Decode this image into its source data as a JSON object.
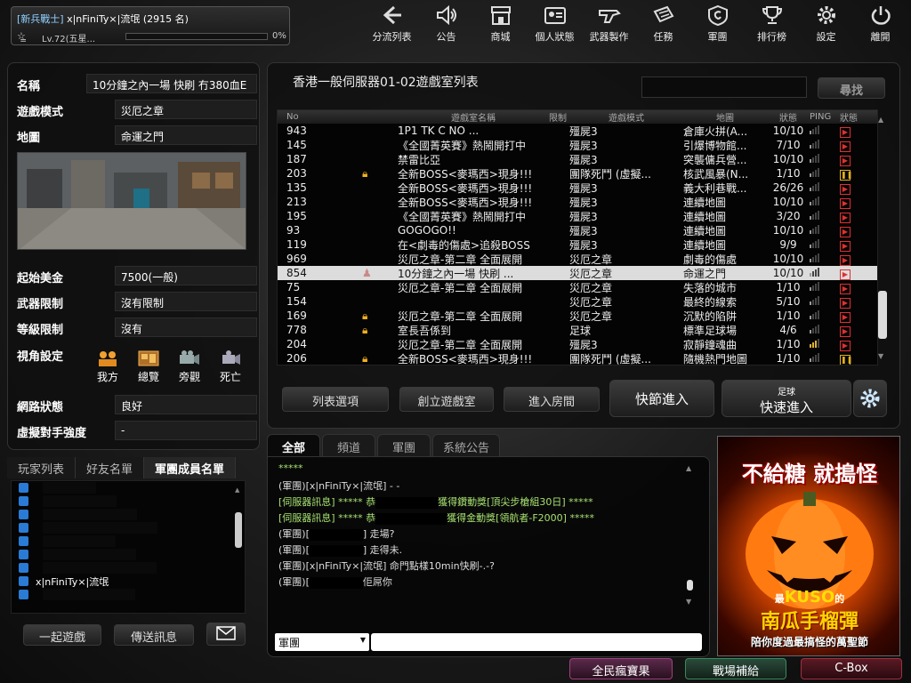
{
  "player": {
    "clan_tag": "[新兵戰士]",
    "name": "x|nFiniTy×|流氓",
    "score": "(2915 名)",
    "level": "Lv.72(五星...",
    "exp_pct": "0%",
    "exp_fill": 0.0
  },
  "nav": [
    {
      "id": "nav-channel",
      "label": "分流列表",
      "icon": "back-arrow-icon"
    },
    {
      "id": "nav-news",
      "label": "公告",
      "icon": "speaker-icon"
    },
    {
      "id": "nav-shop",
      "label": "商城",
      "icon": "shop-icon"
    },
    {
      "id": "nav-profile",
      "label": "個人狀態",
      "icon": "id-card-icon"
    },
    {
      "id": "nav-craft",
      "label": "武器製作",
      "icon": "gun-icon"
    },
    {
      "id": "nav-mission",
      "label": "任務",
      "icon": "mission-icon"
    },
    {
      "id": "nav-clan",
      "label": "軍團",
      "icon": "clan-icon"
    },
    {
      "id": "nav-rank",
      "label": "排行榜",
      "icon": "trophy-icon"
    },
    {
      "id": "nav-settings",
      "label": "設定",
      "icon": "gear-icon"
    },
    {
      "id": "nav-exit",
      "label": "離開",
      "icon": "power-icon"
    }
  ],
  "room_info": {
    "name_label": "名稱",
    "name_value": "10分鐘之內一場 快刷 冇380血E",
    "mode_label": "遊戲模式",
    "mode_value": "災厄之章",
    "map_label": "地圖",
    "map_value": "命運之門",
    "money_label": "起始美金",
    "money_value": "7500(一般)",
    "weapon_label": "武器限制",
    "weapon_value": "沒有限制",
    "level_label": "等級限制",
    "level_value": "沒有",
    "view_label": "視角設定",
    "views": [
      "我方",
      "總覽",
      "旁觀",
      "死亡"
    ],
    "net_label": "網路狀態",
    "net_value": "良好",
    "ai_label": "虛擬對手強度",
    "ai_value": "-"
  },
  "player_tabs": [
    "玩家列表",
    "好友名單",
    "軍團成員名單"
  ],
  "player_list": [
    "",
    "",
    "",
    "",
    "",
    "",
    "",
    "x|nFiniTy×|流氓",
    ""
  ],
  "player_buttons": {
    "play_together": "一起遊戲",
    "send_message": "傳送訊息"
  },
  "room_list": {
    "title": "香港一般伺服器01-02遊戲室列表",
    "search_btn": "尋找",
    "search_value": "",
    "headers": {
      "no": "No",
      "name": "遊戲室名稱",
      "limit": "限制",
      "mode": "遊戲模式",
      "map": "地圖",
      "status": "狀態",
      "ping": "PING",
      "state": "狀態"
    },
    "rows": [
      {
        "no": "943",
        "lock": false,
        "name": "1P1  TK  C NO  ...",
        "mode": "殭屍3",
        "map": "倉庫火拼(A...",
        "status": "10/10",
        "ping": 1,
        "act": "play"
      },
      {
        "no": "145",
        "lock": false,
        "name": "《全國菁英賽》熱鬧開打中",
        "mode": "殭屍3",
        "map": "引爆博物館...",
        "status": "7/10",
        "ping": 1,
        "act": "play"
      },
      {
        "no": "187",
        "lock": false,
        "name": "禁雷比亞",
        "mode": "殭屍3",
        "map": "突襲傭兵營...",
        "status": "10/10",
        "ping": 1,
        "act": "play"
      },
      {
        "no": "203",
        "lock": true,
        "name": "全新BOSS<麥瑪西>現身!!!",
        "mode": "團隊死鬥 (虛擬...",
        "map": "核武風暴(N...",
        "status": "1/10",
        "ping": 1,
        "act": "pause"
      },
      {
        "no": "135",
        "lock": false,
        "name": "全新BOSS<麥瑪西>現身!!!",
        "mode": "殭屍3",
        "map": "義大利巷戰...",
        "status": "26/26",
        "ping": 1,
        "act": "play"
      },
      {
        "no": "213",
        "lock": false,
        "name": "全新BOSS<麥瑪西>現身!!!",
        "mode": "殭屍3",
        "map": "連續地圖",
        "status": "10/10",
        "ping": 1,
        "act": "play"
      },
      {
        "no": "195",
        "lock": false,
        "name": "《全國菁英賽》熱鬧開打中",
        "mode": "殭屍3",
        "map": "連續地圖",
        "status": "3/20",
        "ping": 1,
        "act": "play"
      },
      {
        "no": "93",
        "lock": false,
        "name": "GOGOGO!!",
        "mode": "殭屍3",
        "map": "連續地圖",
        "status": "10/10",
        "ping": 1,
        "act": "play"
      },
      {
        "no": "119",
        "lock": false,
        "name": "在<劇毒的傷處>追殺BOSS",
        "mode": "殭屍3",
        "map": "連續地圖",
        "status": "9/9",
        "ping": 1,
        "act": "play"
      },
      {
        "no": "969",
        "lock": false,
        "name": "災厄之章-第二章 全面展開",
        "mode": "災厄之章",
        "map": "劇毒的傷處",
        "status": "10/10",
        "ping": 1,
        "act": "play"
      },
      {
        "no": "854",
        "lock": false,
        "host": true,
        "name": "10分鐘之內一場 快刷 ...",
        "mode": "災厄之章",
        "map": "命運之門",
        "status": "10/10",
        "ping": 1,
        "act": "play",
        "selected": true
      },
      {
        "no": "75",
        "lock": false,
        "name": "災厄之章-第二章 全面展開",
        "mode": "災厄之章",
        "map": "失落的城市",
        "status": "1/10",
        "ping": 1,
        "act": "play"
      },
      {
        "no": "154",
        "lock": false,
        "name": "",
        "mode": "災厄之章",
        "map": "最終的線索",
        "status": "5/10",
        "ping": 1,
        "act": "play"
      },
      {
        "no": "169",
        "lock": true,
        "name": "災厄之章-第二章 全面展開",
        "mode": "災厄之章",
        "map": "沉默的陷阱",
        "status": "1/10",
        "ping": 1,
        "act": "play"
      },
      {
        "no": "778",
        "lock": true,
        "name": "室長吾係到",
        "mode": "足球",
        "map": "標準足球場",
        "status": "4/6",
        "ping": 1,
        "act": "play"
      },
      {
        "no": "204",
        "lock": false,
        "name": "災厄之章-第二章 全面展開",
        "mode": "殭屍3",
        "map": "寂靜鐘魂曲",
        "status": "1/10",
        "ping": 3,
        "act": "play"
      },
      {
        "no": "206",
        "lock": true,
        "name": "全新BOSS<麥瑪西>現身!!!",
        "mode": "團隊死鬥 (虛擬...",
        "map": "隨機熱門地圖",
        "status": "1/10",
        "ping": 1,
        "act": "pause"
      }
    ],
    "buttons": {
      "options": "列表選項",
      "create": "創立遊戲室",
      "join": "進入房間",
      "quick": "快節進入",
      "soccer_sub": "足球",
      "soccer_quick": "快速進入"
    }
  },
  "chat": {
    "tabs": [
      "全部",
      "頻道",
      "軍團",
      "系統公告"
    ],
    "lines": [
      {
        "text": "*****",
        "color": "#a6e070"
      },
      {
        "text": "(軍團)[x|nFiniTy×|流氓] - -",
        "color": "#dddddd"
      },
      {
        "text": "[伺服器訊息] ***** 恭",
        "censor": 70,
        "rest": "獲得鑽動獎[頂尖步槍組30日] *****",
        "color": "#a6e070"
      },
      {
        "text": "[伺服器訊息] ***** 恭",
        "censor": 80,
        "rest": "獲得金動獎[領航者-F2000] *****",
        "color": "#a6e070"
      },
      {
        "text": "(軍團)[",
        "censor": 60,
        "rest": "] 走場?",
        "color": "#dddddd"
      },
      {
        "text": "(軍團)[",
        "censor": 60,
        "rest": "] 走得未.",
        "color": "#dddddd"
      },
      {
        "text": "(軍團)[x|nFiniTy×|流氓] 命門點樣10min快刷-.-?",
        "color": "#dddddd"
      },
      {
        "text": "(軍團)[",
        "censor": 60,
        "rest": "佢屌你",
        "color": "#dddddd"
      }
    ],
    "channel_value": "軍團",
    "input_value": ""
  },
  "ad": {
    "top_text": "不給糖 就搗怪",
    "kuso_prefix": "最",
    "kuso": "KUSO",
    "kuso_suffix": "的",
    "product": "南瓜手榴彈",
    "tagline": "陪你度過最搞怪的萬聖節"
  },
  "bottom": {
    "lottery": "全民瘋寶果",
    "supply": "戰場補給",
    "cbox": "C-Box"
  }
}
